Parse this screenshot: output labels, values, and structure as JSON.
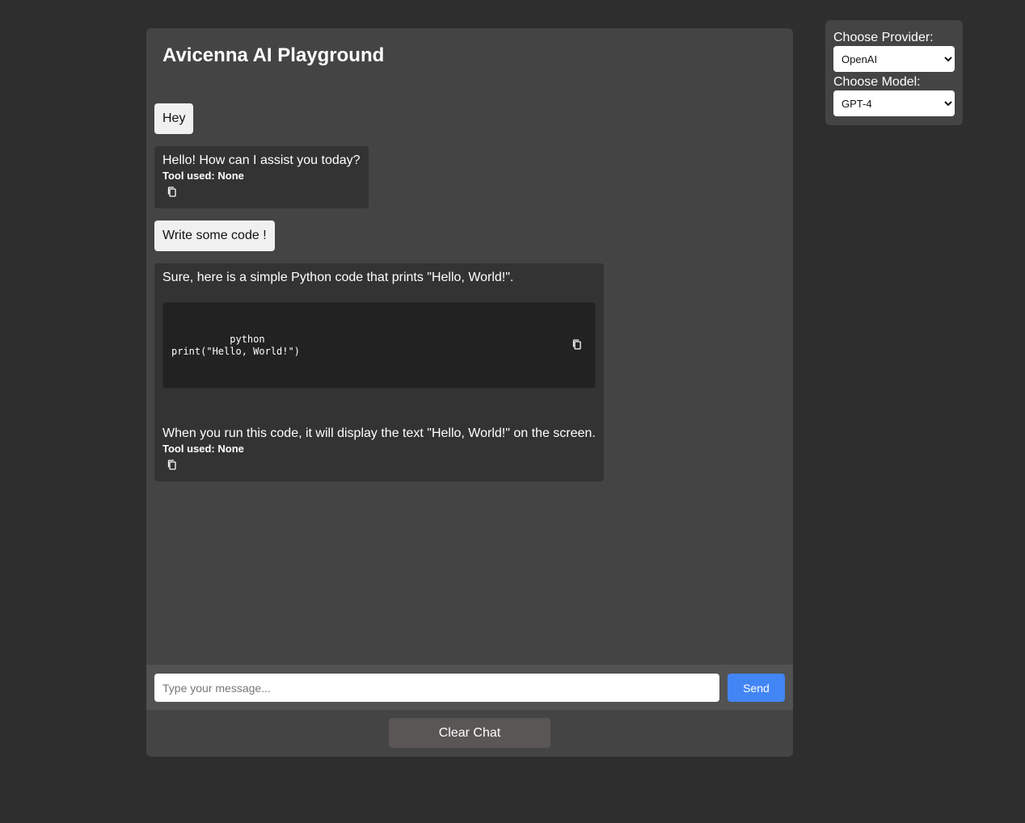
{
  "app": {
    "title": "Avicenna AI Playground"
  },
  "messages": [
    {
      "role": "user",
      "text": "Hey"
    },
    {
      "role": "assistant",
      "text": "Hello! How can I assist you today?",
      "tool_label": "Tool used: None"
    },
    {
      "role": "user",
      "text": "Write some code !"
    },
    {
      "role": "assistant",
      "intro": "Sure, here is a simple Python code that prints \"Hello, World!\".",
      "code": "python\nprint(\"Hello, World!\")",
      "outro": "When you run this code, it will display the text \"Hello, World!\" on the screen.",
      "tool_label": "Tool used: None"
    }
  ],
  "input": {
    "placeholder": "Type your message...",
    "value": "",
    "send_label": "Send"
  },
  "actions": {
    "clear_label": "Clear Chat"
  },
  "settings": {
    "provider_label": "Choose Provider:",
    "provider_selected": "OpenAI",
    "model_label": "Choose Model:",
    "model_selected": "GPT-4"
  },
  "icons": {
    "copy": "copy-icon"
  },
  "colors": {
    "page_bg": "#2e2e2e",
    "panel_bg": "#444444",
    "user_bubble": "#f0f0f0",
    "assistant_bubble": "#333333",
    "code_bg": "#222222",
    "send_button": "#4285f4",
    "clear_button": "#5a5655"
  }
}
